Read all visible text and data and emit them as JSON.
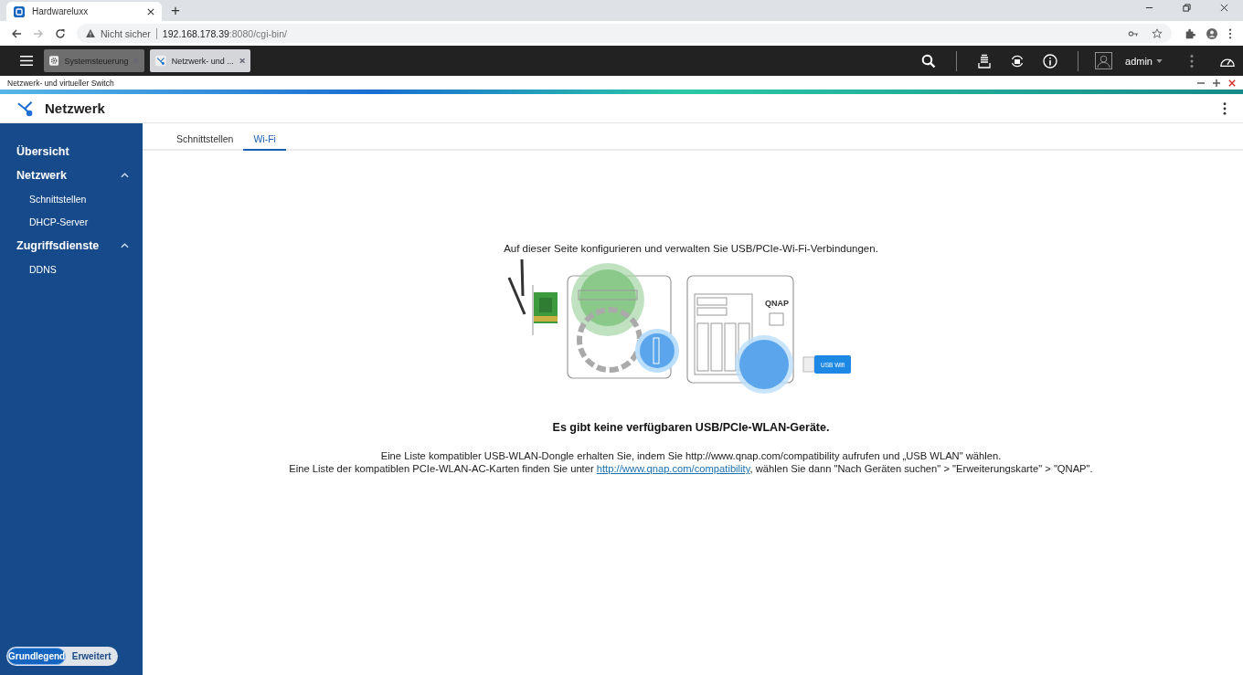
{
  "browser": {
    "tabs": [
      {
        "title": "Hardwareluxx",
        "selected": true
      }
    ],
    "new_tab": "+",
    "security": "Nicht sicher",
    "url_host": "192.168.178.39",
    "url_rest": ":8080/cgi-bin/"
  },
  "app_bar": {
    "windows": [
      {
        "title": "Systemsteuerung",
        "selected": false,
        "kind": "settings"
      },
      {
        "title": "Netzwerk- und ...",
        "selected": true,
        "kind": "network"
      }
    ],
    "user": "admin"
  },
  "window": {
    "title": "Netzwerk- und virtueller Switch"
  },
  "header": {
    "title": "Netzwerk"
  },
  "sidebar": {
    "items": [
      {
        "label": "Übersicht"
      },
      {
        "label": "Netzwerk",
        "expanded": true,
        "children": [
          {
            "label": "Schnittstellen"
          },
          {
            "label": "DHCP-Server"
          }
        ]
      },
      {
        "label": "Zugriffsdienste",
        "expanded": true,
        "children": [
          {
            "label": "DDNS"
          }
        ]
      }
    ],
    "mode_toggle": [
      {
        "label": "Grundlegend",
        "selected": true
      },
      {
        "label": "Erweitert",
        "selected": false
      }
    ]
  },
  "tabs": [
    {
      "label": "Schnittstellen",
      "selected": false
    },
    {
      "label": "Wi-Fi",
      "selected": true
    }
  ],
  "content": {
    "intro": "Auf dieser Seite konfigurieren und verwalten Sie USB/PCIe-Wi-Fi-Verbindungen.",
    "illustration": {
      "nas_label": "QNAP",
      "dongle_label": "USB Wifi"
    },
    "heading": "Es gibt keine verfügbaren USB/PCIe-WLAN-Geräte.",
    "line_1": "Eine Liste kompatibler USB-WLAN-Dongle erhalten Sie, indem Sie http://www.qnap.com/compatibility aufrufen und „USB WLAN\" wählen.",
    "line_2": {
      "before": "Eine Liste der kompatiblen PCIe-WLAN-AC-Karten finden Sie unter ",
      "link": "http://www.qnap.com/compatibility",
      "after": ", wählen Sie dann \"Nach Geräten suchen\" > \"Erweiterungskarte\" > \"QNAP\"."
    }
  }
}
